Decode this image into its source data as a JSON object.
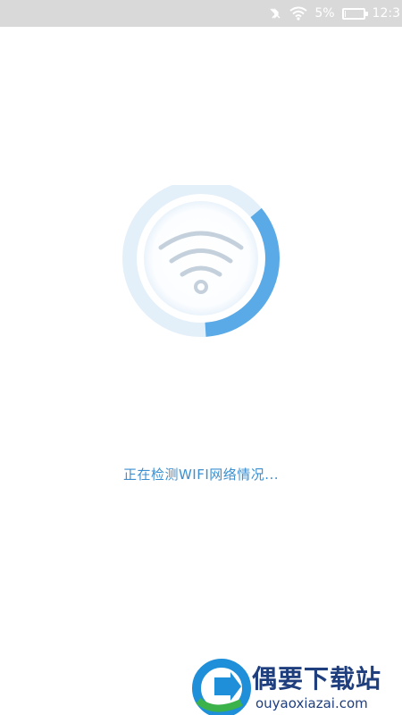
{
  "status_bar": {
    "battery_percent": "5%",
    "battery_level": 0.05,
    "time": "12:3",
    "icons": [
      "nfc-off-icon",
      "wifi-icon",
      "battery-icon"
    ]
  },
  "main": {
    "wifi_icon": "wifi-icon",
    "progress_fraction": 0.35,
    "status_text": "正在检测WIFI网络情况..."
  },
  "watermark": {
    "title": "偶要下载站",
    "url": "ouyaoxiazai.com"
  },
  "colors": {
    "accent": "#3d8fcf",
    "ring_light": "#dcebf8",
    "ring_progress": "#5aaae8",
    "status_bar_bg": "#d9d9d9"
  }
}
